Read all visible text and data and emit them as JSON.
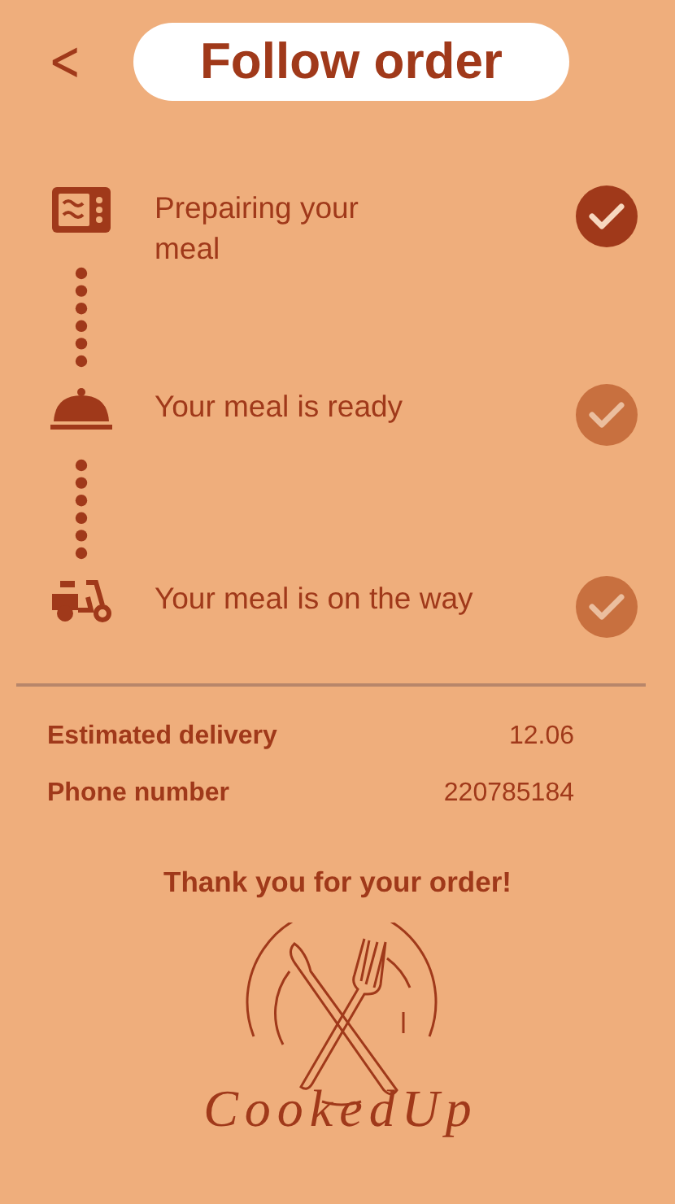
{
  "header": {
    "back": "<",
    "title": "Follow order"
  },
  "steps": [
    {
      "kind": "cooking",
      "label": "Prepairing your meal",
      "done": true
    },
    {
      "kind": "ready",
      "label": "Your meal is ready",
      "done": false
    },
    {
      "kind": "delivery",
      "label": "Your meal is on the way",
      "done": false
    }
  ],
  "details": [
    {
      "label": "Estimated delivery",
      "value": "12.06"
    },
    {
      "label": "Phone number",
      "value": "220785184"
    }
  ],
  "thanks": "Thank you for your order!",
  "logo": {
    "name": "CookedUp"
  }
}
